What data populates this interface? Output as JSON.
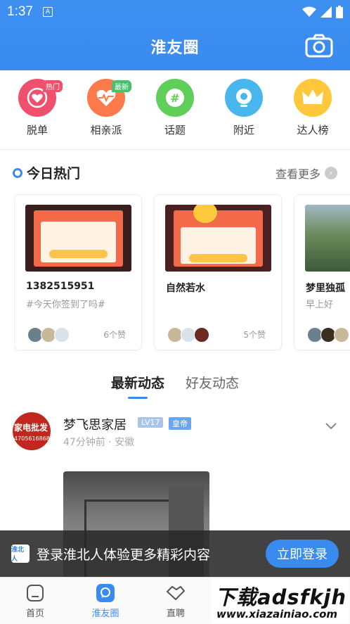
{
  "status": {
    "time": "1:37"
  },
  "header": {
    "title": "淮友圈"
  },
  "categories": [
    {
      "label": "脱单",
      "badge": "热门",
      "color": "#f0506e"
    },
    {
      "label": "相亲派",
      "badge": "最新",
      "color": "#ff7a4a"
    },
    {
      "label": "话题",
      "badge": "",
      "color": "#5fcf5a"
    },
    {
      "label": "附近",
      "badge": "",
      "color": "#4ab6ee"
    },
    {
      "label": "达人榜",
      "badge": "",
      "color": "#ffc83c"
    }
  ],
  "hot": {
    "title": "今日热门",
    "more": "查看更多",
    "cards": [
      {
        "name": "1382515951",
        "desc": "#今天你签到了吗#",
        "likes": "6个赞"
      },
      {
        "name": "自然若水",
        "desc": "",
        "likes": "5个赞"
      },
      {
        "name": "梦里独孤",
        "desc": "早上好",
        "likes": ""
      }
    ]
  },
  "tabs": [
    {
      "label": "最新动态"
    },
    {
      "label": "好友动态"
    }
  ],
  "post": {
    "username": "梦飞思家居",
    "level": "LV17",
    "rank": "皇帝",
    "meta": "47分钟前 · 安徽",
    "avatar_text": "家电批发",
    "avatar_phone": "4705616868"
  },
  "banner": {
    "text": "登录淮北人体验更多精彩内容",
    "button": "立即登录",
    "logo_text": "淮北人"
  },
  "bottom_nav": [
    {
      "label": "首页"
    },
    {
      "label": "淮友圈"
    },
    {
      "label": "直聘"
    }
  ],
  "watermark": {
    "big": "下载adsfkjh",
    "small": "www.xiazainiao.com"
  }
}
